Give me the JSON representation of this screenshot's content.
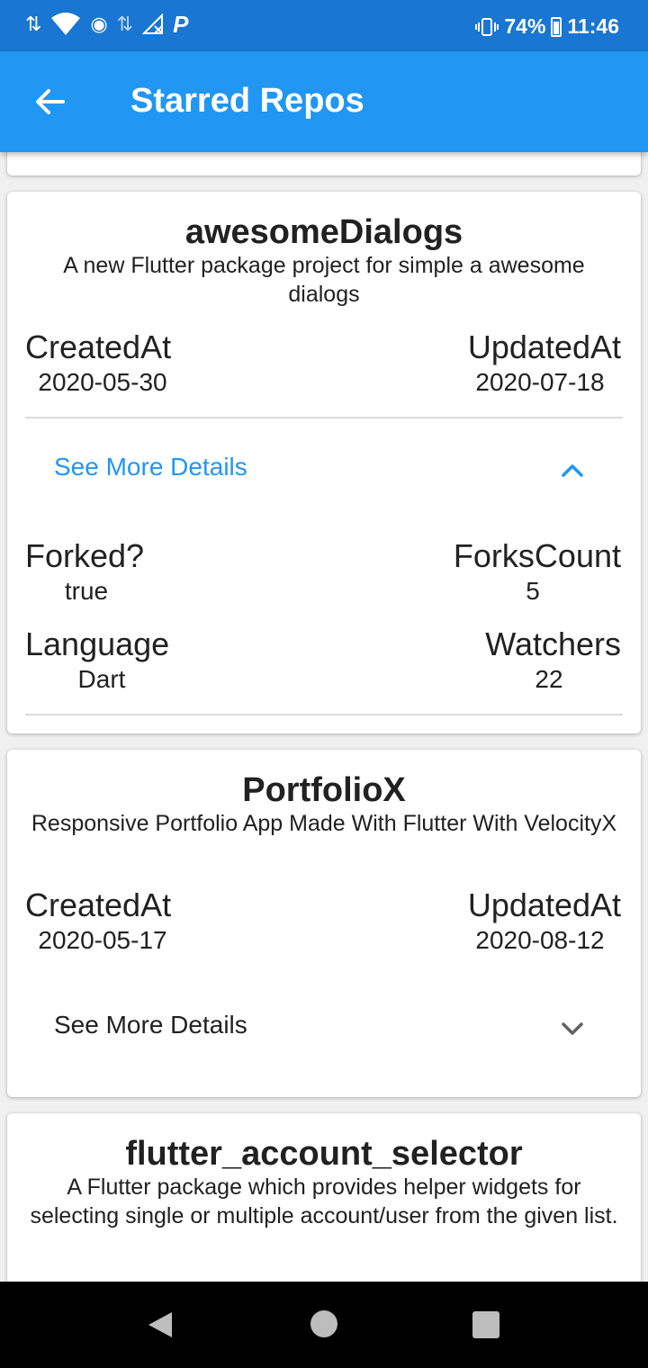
{
  "status_bar": {
    "battery": "74%",
    "time": "11:46",
    "icons": [
      "data-arrows-icon",
      "wifi-icon",
      "hotspot-icon",
      "signal-icon",
      "p-app-icon",
      "vibrate-icon",
      "battery-icon"
    ]
  },
  "app_bar": {
    "title": "Starred Repos",
    "back_icon": "arrow-back-icon"
  },
  "repos": [
    {
      "name": "awesomeDialogs",
      "description": "A new Flutter package project for simple a awesome dialogs",
      "created_label": "CreatedAt",
      "created_value": "2020-05-30",
      "updated_label": "UpdatedAt",
      "updated_value": "2020-07-18",
      "expand_label": "See More Details",
      "expanded": true,
      "forked_label": "Forked?",
      "forked_value": "true",
      "forks_label": "ForksCount",
      "forks_value": "5",
      "language_label": "Language",
      "language_value": "Dart",
      "watchers_label": "Watchers",
      "watchers_value": "22"
    },
    {
      "name": "PortfolioX",
      "description": "Responsive Portfolio App Made With Flutter With VelocityX",
      "created_label": "CreatedAt",
      "created_value": "2020-05-17",
      "updated_label": "UpdatedAt",
      "updated_value": "2020-08-12",
      "expand_label": "See More Details",
      "expanded": false
    },
    {
      "name": "flutter_account_selector",
      "description": "A Flutter package which provides helper widgets for selecting single or multiple account/user from the given list."
    }
  ],
  "colors": {
    "status_bar": "#1976d2",
    "app_bar": "#2196f3",
    "accent": "#2196f3",
    "background": "#f0f0f0"
  }
}
